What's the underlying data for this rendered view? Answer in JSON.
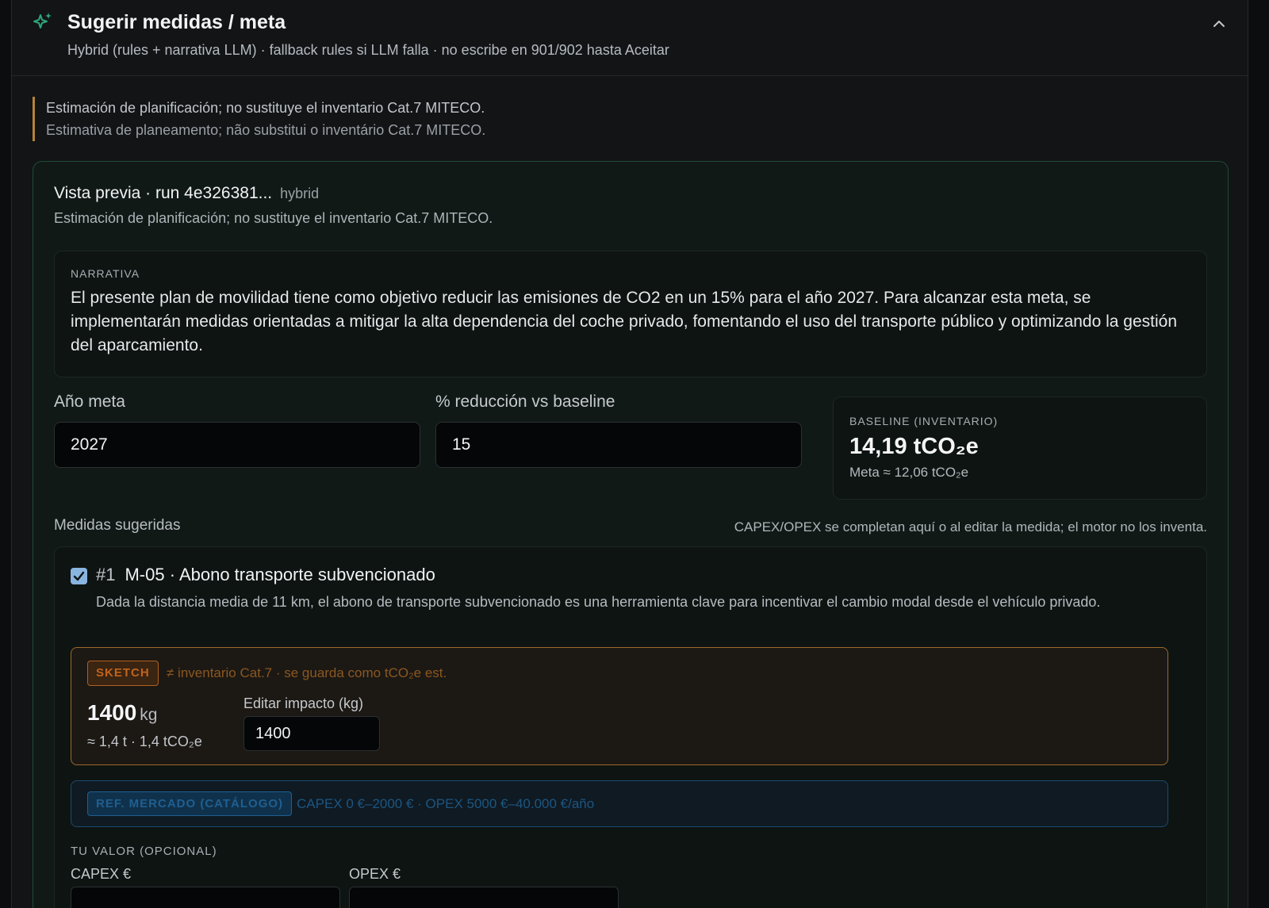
{
  "header": {
    "title": "Sugerir medidas / meta",
    "subtitle": "Hybrid (rules + narrativa LLM) · fallback rules si LLM falla · no escribe en 901/902 hasta Aceitar",
    "icon": "sparkle-icon",
    "collapse_icon": "chevron-up-icon",
    "accent_color": "#2fa57a"
  },
  "disclaimer": {
    "es": "Estimación de planificación; no sustituye el inventario Cat.7 MITECO.",
    "pt": "Estimativa de planeamento; não substitui o inventário Cat.7 MITECO."
  },
  "preview": {
    "title": "Vista previa · run 4e326381...",
    "mode": "hybrid",
    "note": "Estimación de planificación; no sustituye el inventario Cat.7 MITECO.",
    "narrative_caption": "NARRATIVA",
    "narrative": "El presente plan de movilidad tiene como objetivo reducir las emisiones de CO2 en un 15% para el año 2027. Para alcanzar esta meta, se implementarán medidas orientadas a mitigar la alta dependencia del coche privado, fomentando el uso del transporte público y optimizando la gestión del aparcamiento.",
    "target_year_label": "Año meta",
    "target_year_value": "2027",
    "reduction_label": "% reducción vs baseline",
    "reduction_value": "15",
    "baseline_caption": "BASELINE (INVENTARIO)",
    "baseline_value": "14,19 tCO₂e",
    "baseline_meta": "Meta ≈ 12,06 tCO₂e"
  },
  "measures": {
    "section_label": "Medidas sugeridas",
    "section_note": "CAPEX/OPEX se completan aquí o al editar la medida; el motor no los inventa.",
    "items": [
      {
        "checked": true,
        "num": "#1",
        "title": "M-05 · Abono transporte subvencionado",
        "description": "Dada la distancia media de 11 km, el abono de transporte subvencionado es una herramienta clave para incentivar el cambio modal desde el vehículo privado.",
        "sketch_badge": "SKETCH",
        "sketch_note": "≠ inventario Cat.7 · se guarda como tCO₂e est.",
        "impact_value": "1400",
        "impact_unit": "kg",
        "impact_approx": "≈ 1,4 t · 1,4 tCO₂e",
        "edit_label": "Editar impacto (kg)",
        "edit_value": "1400",
        "market_badge": "REF. MERCADO (CATÁLOGO)",
        "market_note": "CAPEX 0 €–2000 € · OPEX 5000 €–40.000 €/año",
        "your_value_label": "TU VALOR (OPCIONAL)",
        "capex_label": "CAPEX €",
        "opex_label": "OPEX €",
        "capex_value": "",
        "opex_value": ""
      }
    ]
  }
}
